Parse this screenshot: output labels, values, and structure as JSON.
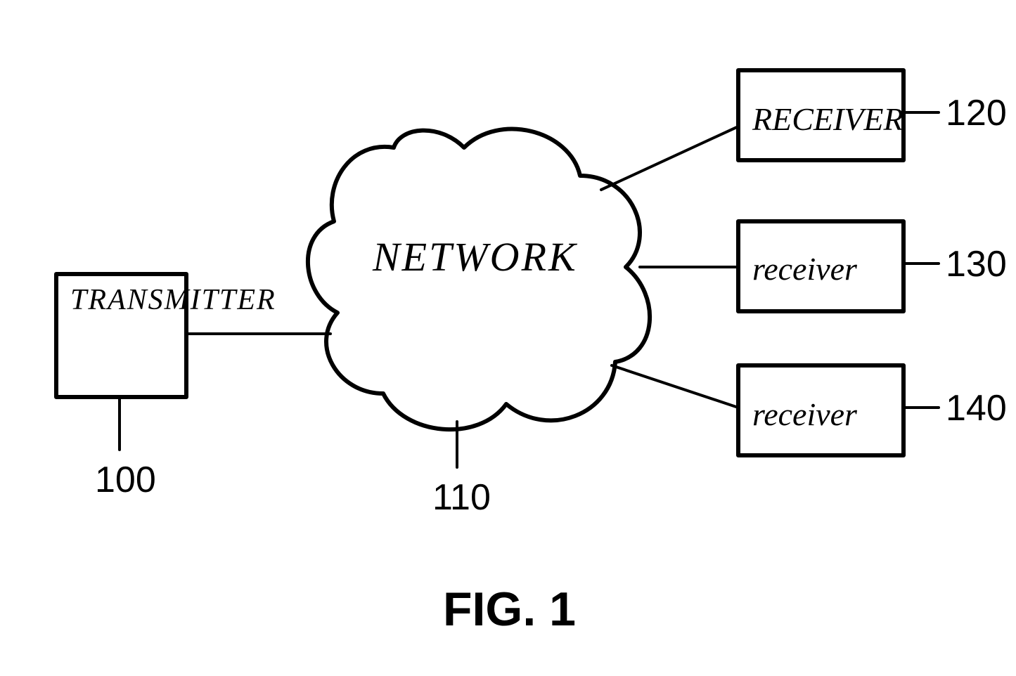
{
  "figure_label": "FIG. 1",
  "blocks": {
    "transmitter": {
      "label": "TRANSMITTER",
      "ref": "100"
    },
    "network": {
      "label": "NETWORK",
      "ref": "110"
    },
    "receiver1": {
      "label": "RECEIVER",
      "ref": "120"
    },
    "receiver2": {
      "label": "receiver",
      "ref": "130"
    },
    "receiver3": {
      "label": "receiver",
      "ref": "140"
    }
  }
}
